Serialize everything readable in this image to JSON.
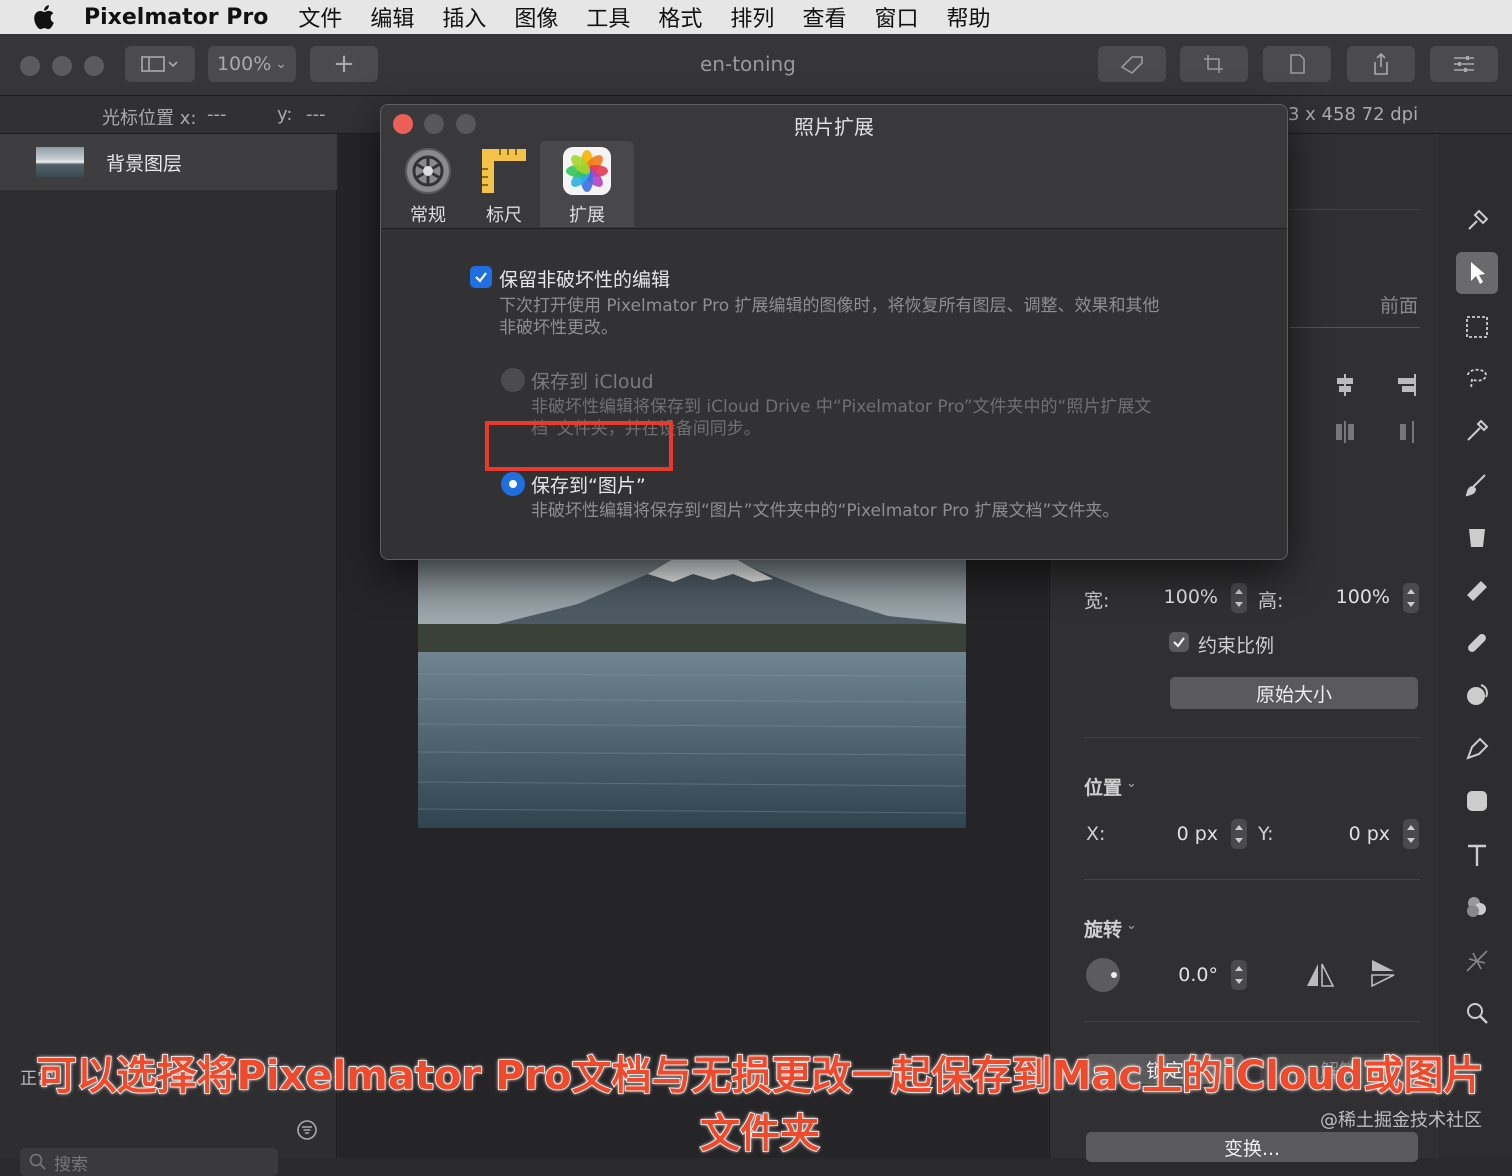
{
  "menubar": {
    "app_name": "Pixelmator Pro",
    "items": [
      "文件",
      "编辑",
      "插入",
      "图像",
      "工具",
      "格式",
      "排列",
      "查看",
      "窗口",
      "帮助"
    ]
  },
  "toolbar": {
    "zoom": "100%",
    "add_label": "+",
    "doc_title": "en-toning"
  },
  "infobar": {
    "cursor_x_label": "光标位置 x:",
    "cursor_x_value": "---",
    "cursor_y_label": "y:",
    "cursor_y_value": "---",
    "image_info": "3 x 458 72 dpi"
  },
  "layers": {
    "items": [
      {
        "name": "背景图层"
      }
    ],
    "blend_mode": "正常",
    "search_placeholder": "搜索"
  },
  "dialog": {
    "title": "照片扩展",
    "tabs": [
      {
        "label": "常规",
        "icon": "gear-icon"
      },
      {
        "label": "标尺",
        "icon": "ruler-icon"
      },
      {
        "label": "扩展",
        "icon": "photos-icon"
      }
    ],
    "options": {
      "nondestructive": {
        "label": "保留非破坏性的编辑",
        "description_line1": "下次打开使用 Pixelmator Pro 扩展编辑的图像时，将恢复所有图层、调整、效果和其他",
        "description_line2": "非破坏性更改。",
        "checked": true
      },
      "icloud": {
        "label": "保存到 iCloud",
        "description_line1": "非破坏性编辑将保存到 iCloud Drive 中“Pixelmator Pro”文件夹中的“照片扩展文",
        "description_line2": "档”文件夹，并在设备间同步。",
        "selected": false
      },
      "photos": {
        "label": "保存到“图片”",
        "description": "非破坏性编辑将保存到“图片”文件夹中的“Pixelmator Pro 扩展文档”文件夹。",
        "selected": true
      }
    }
  },
  "inspector": {
    "front_label": "前面",
    "width_label": "宽:",
    "width_value": "100%",
    "height_label": "高:",
    "height_value": "100%",
    "constrain_label": "约束比例",
    "original_size_button": "原始大小",
    "position_section": "位置",
    "x_label": "X:",
    "x_value": "0 px",
    "y_label": "Y:",
    "y_value": "0 px",
    "rotation_section": "旋转",
    "rotation_value": "0.0°",
    "lock_button": "锁定",
    "unlock_button": "解锁",
    "transform_button": "变换..."
  },
  "caption": "可以选择将Pixelmator Pro文档与无损更改一起保存到Mac上的iCloud或图片文件夹",
  "watermark": "@稀土掘金技术社区",
  "colors": {
    "accent": "#1f6fe0",
    "highlight": "#e8392c",
    "caption": "#f04a2c"
  }
}
